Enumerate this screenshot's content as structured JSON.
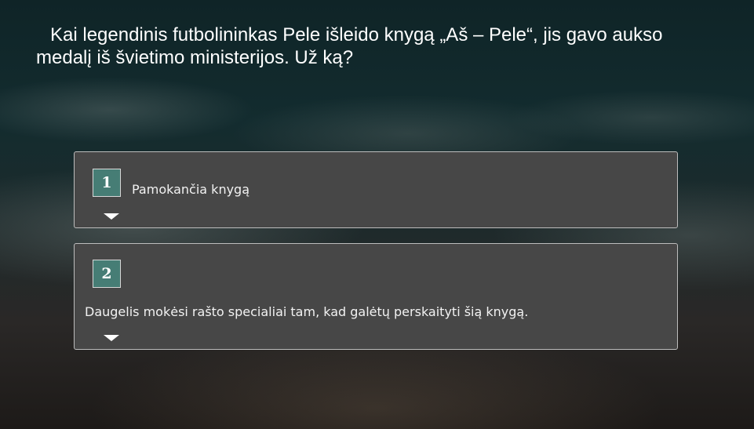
{
  "question": {
    "text": "Kai legendinis futbolininkas Pele išleido knygą „Aš – Pele“, jis gavo aukso medalį iš švietimo ministerijos. Už ką?"
  },
  "answers": [
    {
      "number": "1",
      "text": "Pamokančia knygą"
    },
    {
      "number": "2",
      "text": "Daugelis mokėsi rašto specialiai tam, kad galėtų perskaityti šią knygą."
    }
  ],
  "colors": {
    "badge": "#467d75",
    "card": "#474747",
    "card_border": "#bdbdbd"
  },
  "icons": {
    "expand": "chevron-down-icon"
  }
}
